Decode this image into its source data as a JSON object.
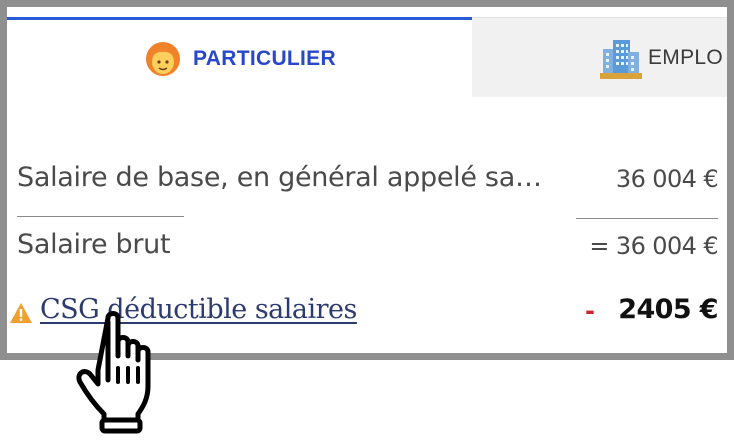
{
  "tabs": [
    {
      "label": "PARTICULIER",
      "icon": "person-icon",
      "active": true
    },
    {
      "label": "EMPLO",
      "icon": "building-icon",
      "active": false
    }
  ],
  "rows": {
    "base_salary": {
      "label": "Salaire de base, en général appelé sa…",
      "value": "36 004 €"
    },
    "gross_salary": {
      "label": "Salaire brut",
      "value": "= 36 004 €"
    },
    "csg": {
      "label": "CSG déductible salaires",
      "sign": "-",
      "value": "2405 €",
      "icon": "warning-icon"
    }
  },
  "colors": {
    "accent": "#2a5cd6",
    "tab_text": "#2947c9",
    "link": "#2c3a6e",
    "negative_sign": "#d0262a",
    "warning": "#f0a030",
    "frame": "#8f8f8f"
  }
}
